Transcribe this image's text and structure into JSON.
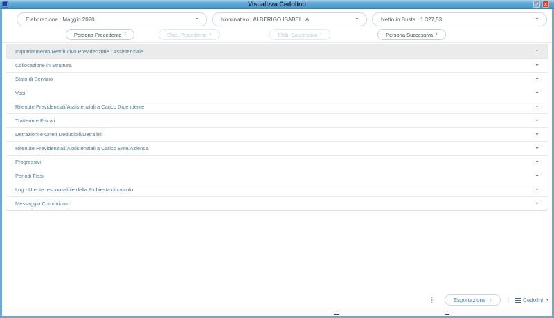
{
  "window": {
    "title": "Visualizza Cedolino",
    "controls": {
      "maximize_glyph": "↗",
      "close_glyph": "×"
    }
  },
  "filters": {
    "elaborazione": {
      "label": "Elaborazione : Maggio 2020",
      "caret": "▾"
    },
    "nominativo": {
      "label": "Nominativo : ALBERIGO ISABELLA",
      "caret": "▾"
    },
    "netto": {
      "label": "Netto in Busta : 1.327,53",
      "caret": "▾"
    }
  },
  "nav_buttons": [
    {
      "label": "Persona Precedente",
      "chevron": "‹",
      "enabled": true
    },
    {
      "label": "Elab. Precedente",
      "chevron": "‹",
      "enabled": false
    },
    {
      "label": "Elab. Successiva",
      "chevron": "›",
      "enabled": false
    },
    {
      "label": "Persona Successiva",
      "chevron": "›",
      "enabled": true
    }
  ],
  "accordion": {
    "caret": "▾",
    "sections": [
      {
        "label": "Inquadramento Retributivo Previdenziale / Assistenziale",
        "active": true
      },
      {
        "label": "Collocazione in Struttura",
        "active": false
      },
      {
        "label": "Stato di Servizio",
        "active": false
      },
      {
        "label": "Voci",
        "active": false
      },
      {
        "label": "Ritenute Previdenziali/Assistenziali a Carico Dipendente",
        "active": false
      },
      {
        "label": "Trattenute Fiscali",
        "active": false
      },
      {
        "label": "Detrazioni e Oneri Deducibili/Detraibili",
        "active": false
      },
      {
        "label": "Ritenute Previdenziali/Assistenziali a Carico Ente/Azienda",
        "active": false
      },
      {
        "label": "Progressivi",
        "active": false
      },
      {
        "label": "Periodi Fissi",
        "active": false
      },
      {
        "label": "Log - Utente responsabile della Richiesta di calcolo",
        "active": false
      },
      {
        "label": "Messaggio Comunicato",
        "active": false
      }
    ]
  },
  "footer": {
    "more_glyph": "⋮",
    "export_label": "Esportazione",
    "export_icon_glyph": "↑",
    "separator": "|",
    "cedolini_label": "Cedolini",
    "cedolini_caret": "▾"
  },
  "status_strip": {
    "marker_glyph": "▴"
  },
  "colors": {
    "titlebar_blue": "#4896ca",
    "window_border": "#71a7d2",
    "accordion_text": "#527a94",
    "active_row_bg": "#ebebeb",
    "accent_link": "#3f81aa",
    "disabled_text": "#b7ccda",
    "close_red": "#cb4437"
  }
}
